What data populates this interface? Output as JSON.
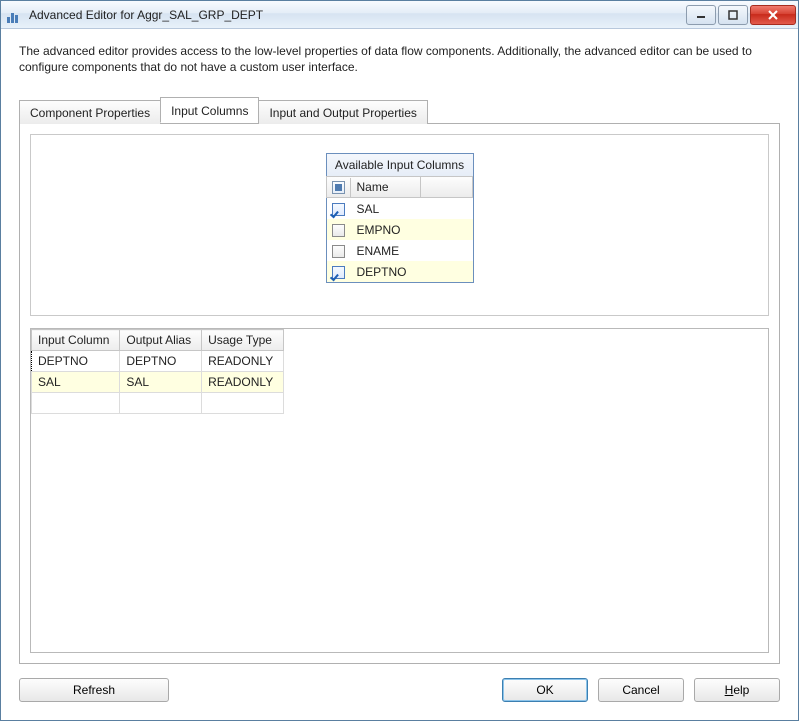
{
  "title": "Advanced Editor for Aggr_SAL_GRP_DEPT",
  "description": "The advanced editor provides access to the low-level properties of data flow components. Additionally, the advanced editor can be used to configure components that do not have a custom user interface.",
  "tabs": {
    "component": "Component Properties",
    "input_cols": "Input Columns",
    "io_props": "Input and Output Properties"
  },
  "available": {
    "header": "Available Input Columns",
    "name_col": "Name",
    "rows": [
      {
        "label": "SAL",
        "checked": true,
        "highlight": false
      },
      {
        "label": "EMPNO",
        "checked": false,
        "highlight": true
      },
      {
        "label": "ENAME",
        "checked": false,
        "highlight": false
      },
      {
        "label": "DEPTNO",
        "checked": true,
        "highlight": true
      }
    ]
  },
  "grid": {
    "headers": {
      "c0": "Input Column",
      "c1": "Output Alias",
      "c2": "Usage Type"
    },
    "rows": [
      {
        "c0": "DEPTNO",
        "c1": "DEPTNO",
        "c2": "READONLY",
        "highlight": false,
        "current": true
      },
      {
        "c0": "SAL",
        "c1": "SAL",
        "c2": "READONLY",
        "highlight": true,
        "current": false
      }
    ]
  },
  "buttons": {
    "refresh": "Refresh",
    "ok": "OK",
    "cancel": "Cancel",
    "help": "elp",
    "help_u": "H"
  }
}
